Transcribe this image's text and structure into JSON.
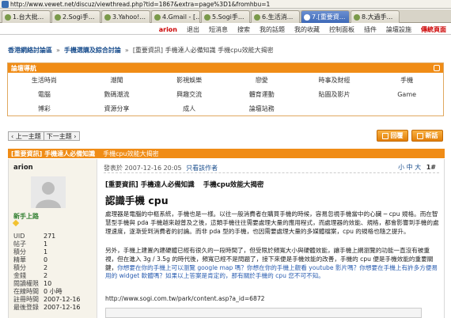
{
  "browser": {
    "url": "http://www.vewet.net/discuz/viewthread.php?tid=1867&extra=page%3D1&fromhbu=1",
    "tabs": [
      {
        "label": "1.台大批..."
      },
      {
        "label": "2.Sogi手..."
      },
      {
        "label": "3.Yahoo!..."
      },
      {
        "label": "4.Gmail - [..."
      },
      {
        "label": "5.Sogi手..."
      },
      {
        "label": "6.生活消..."
      },
      {
        "label": "7.[重要資..."
      },
      {
        "label": "8.大過手..."
      }
    ],
    "active_tab": 6
  },
  "topnav": {
    "user": "arion",
    "items": [
      "退出",
      "短消息",
      "搜索",
      "我的話題",
      "我的收藏",
      "控制面板",
      "插件",
      "論壇設施"
    ],
    "hot": "傳統頁面"
  },
  "breadcrumb": {
    "items": [
      "香港網絡討論區",
      "手機選購及綜合討論"
    ],
    "current": "[重要資訊] 手機達人必備知識  手機cpu效能大揭密"
  },
  "forum_nav": {
    "title": "論壇導航",
    "cells": [
      "生活時尚",
      "潮聞",
      "影視娛樂",
      "戀愛",
      "時事及財經",
      "手機",
      "電腦",
      "數碼潮流",
      "興趣交流",
      "體育運動",
      "貼圖及影片",
      "Game",
      "博彩",
      "資源分享",
      "成人",
      "論壇站務",
      "",
      ""
    ]
  },
  "toolbar": {
    "prev": "‹ 上一主題",
    "next": "下一主題 ›",
    "reply": "回覆",
    "new_post": "新話"
  },
  "thread": {
    "tag": "[重要資訊] 手機達人必備知識",
    "title": "手機cpu效能大揭密"
  },
  "post": {
    "author": "arion",
    "rank": "新手上路",
    "stats": [
      {
        "k": "UID",
        "v": "271"
      },
      {
        "k": "帖子",
        "v": "1"
      },
      {
        "k": "積分",
        "v": "1"
      },
      {
        "k": "精華",
        "v": "0"
      },
      {
        "k": "積分",
        "v": "2"
      },
      {
        "k": "金錢",
        "v": "2"
      },
      {
        "k": "閱讀權限",
        "v": "10"
      },
      {
        "k": "在線時間",
        "v": "0 小時"
      },
      {
        "k": "註冊時間",
        "v": "2007-12-16"
      },
      {
        "k": "最後登錄",
        "v": "2007-12-16"
      }
    ],
    "meta": "發表於 2007-12-16 20:05",
    "meta_link": "只看該作者",
    "font_sizes": "小 中 大",
    "floor": "1#",
    "title_tag": "[重要資訊] 手機達人必備知識",
    "title_main": "手機cpu效能大揭密",
    "heading": "認識手機 cpu",
    "para1": "處理器是電腦的中樞系統，手機也是一樣。以往一般消費者在購買手機的時候，容易忽視手機當中的心臟 ─ cpu 規格。而在智慧型手機與 pda 手機越來越普及之後，這類手機往往需要處理大量的應用程式，而處理器的效能、規格，都會影響到手機的處理速度，逐漸受到消費者的討論。而非 pda 型的手機，也因需要處理大量的多媒體檔案，cpu 的規格也隨之提升。",
    "para2_plain": "另外，手機上建置內建硬體已經有很久的一段時間了，但受限於頻寬大小與硬體效能，讓手機上網瀏覽的功能一直沒有被重視，但在進入 3g / 3.5g 的時代後，頻寬已經不是問題了，接下來便是手機效能的改善，手機的 cpu 便是手機效能的重要關鍵，",
    "para2_question": "你想要在你的手機上可以瀏覽 google map 嗎？你想在你的手機上觀看 youtube 影片嗎？你想要在手機上有許多方便易用的 widget 軟體嗎？如果以上答案是肯定的，那有關於手機的 cpu 您不可不知。",
    "link": "http://www.sogi.com.tw/park/content.asp?a_id=6872"
  }
}
